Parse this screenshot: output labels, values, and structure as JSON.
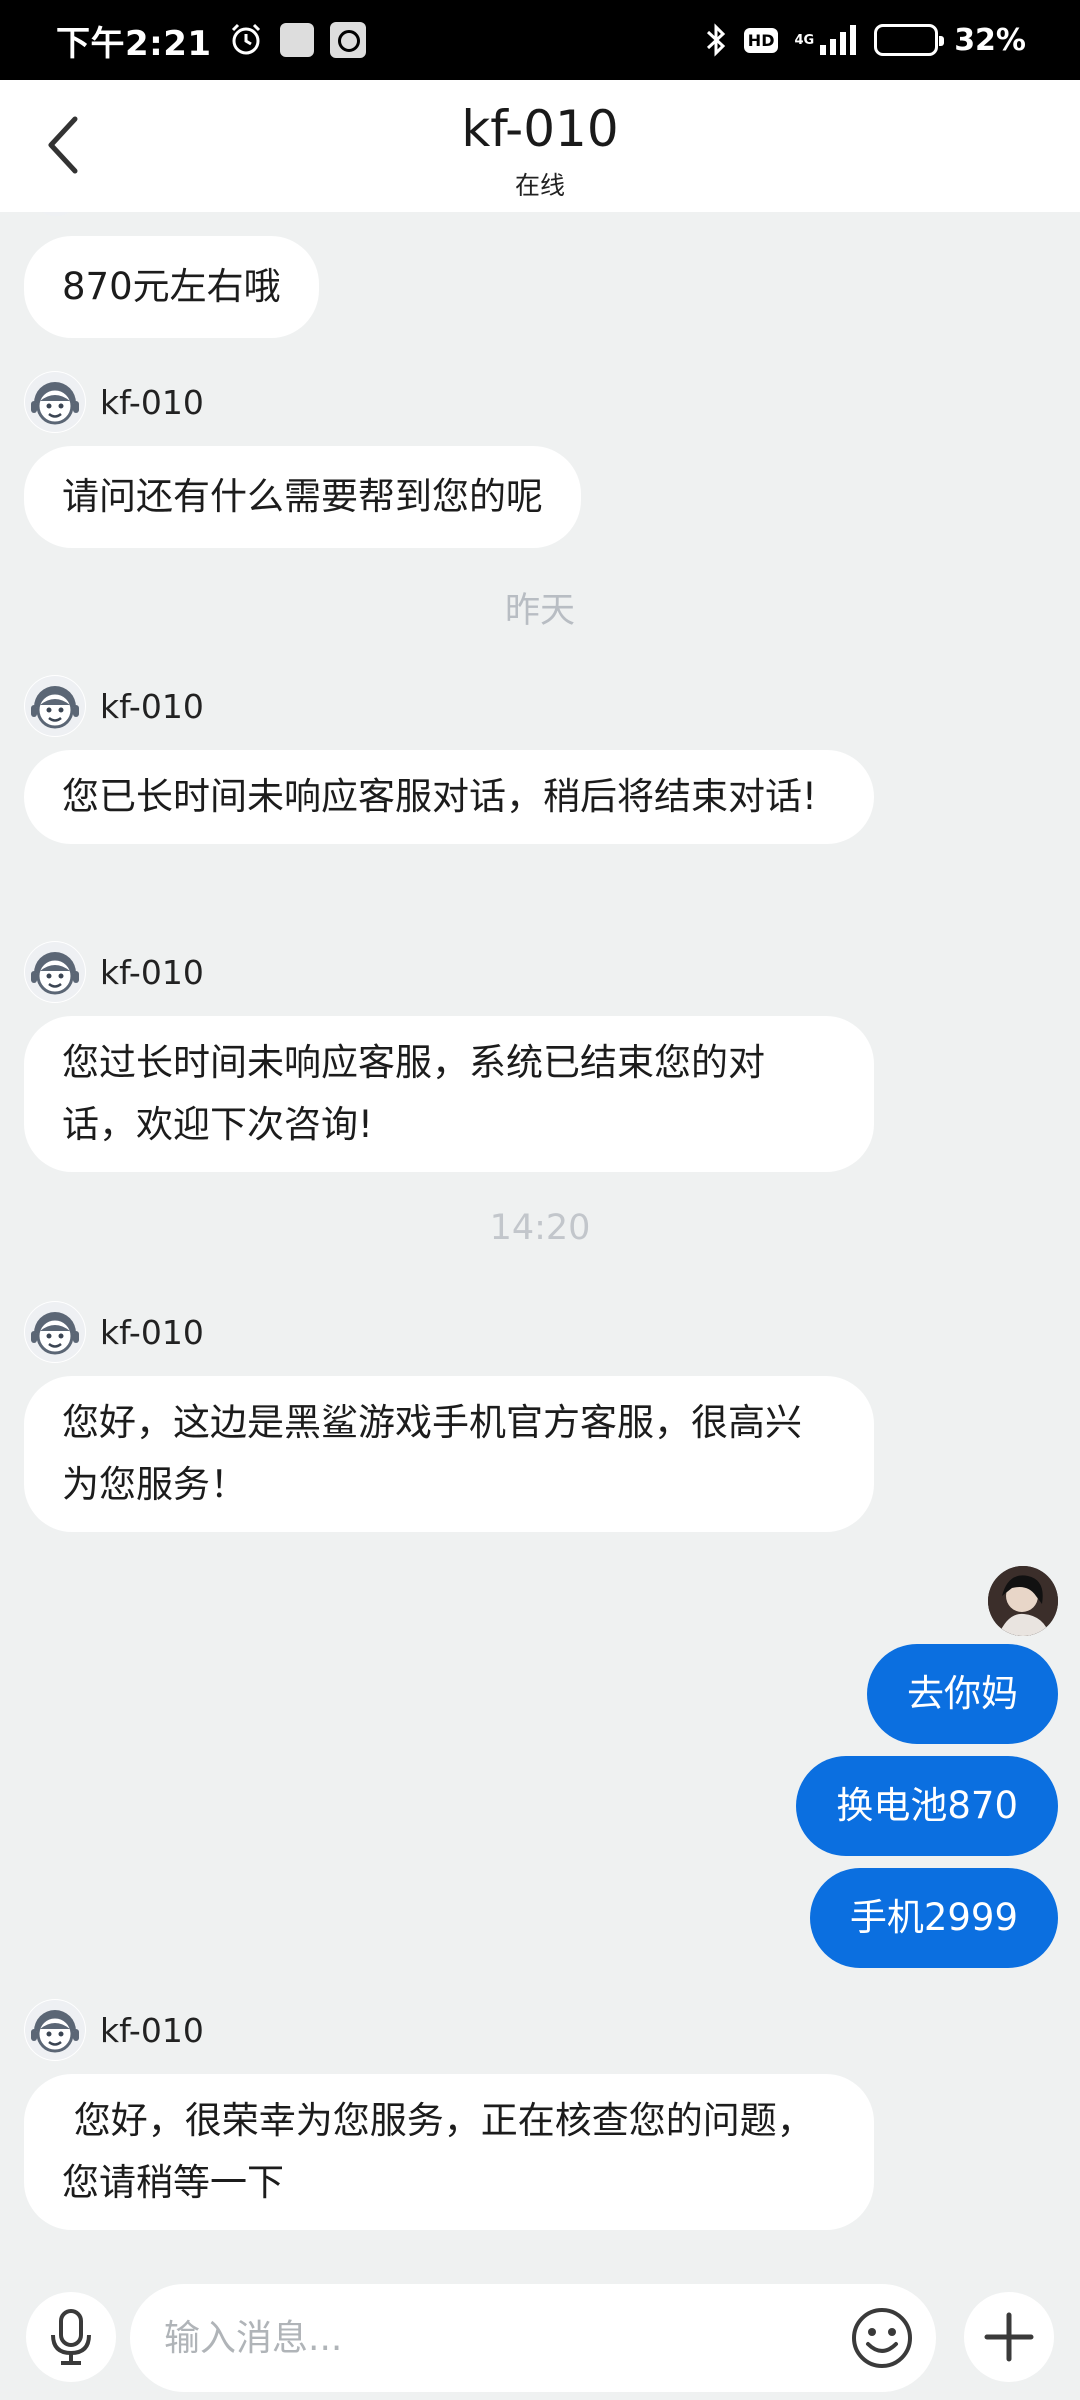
{
  "status_bar": {
    "time": "下午2:21",
    "network": "4G",
    "hd": "HD",
    "battery_percent": "32%",
    "battery_level": 0.32,
    "battery_color": "#f0a020"
  },
  "header": {
    "title": "kf-010",
    "status": "在线",
    "back_icon": "chevron-left-icon"
  },
  "agent_name": "kf-010",
  "messages": {
    "m0": "870元左右哦",
    "m1": "请问还有什么需要帮到您的呢",
    "t1": "昨天",
    "m2": "您已长时间未响应客服对话，稍后将结束对话!",
    "m3": "您过长时间未响应客服，系统已结束您的对话，欢迎下次咨询!",
    "t2": "14:20",
    "m4": "您好，这边是黑鲨游戏手机官方客服，很高兴为您服务！",
    "u1": "去你妈",
    "u2": "换电池870",
    "u3": "手机2999",
    "m5": " 您好，很荣幸为您服务，正在核查您的问题，您请稍等一下"
  },
  "input": {
    "placeholder": "输入消息..."
  },
  "colors": {
    "user_bubble": "#0b6fe0",
    "background": "#eff1f1",
    "timestamp": "#b8bdc3"
  }
}
